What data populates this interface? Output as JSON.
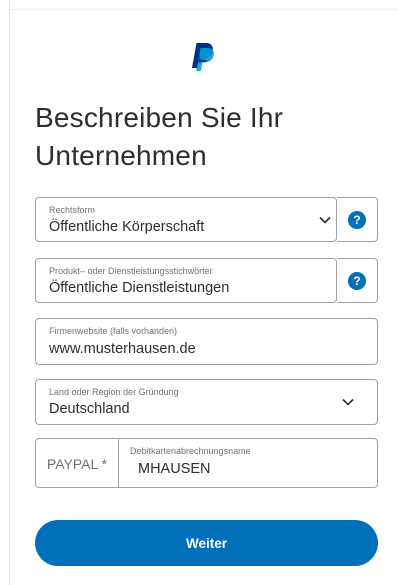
{
  "title": "Beschreiben Sie Ihr Unternehmen",
  "legal_form": {
    "label": "Rechtsform",
    "value": "Öffentliche Körperschaft"
  },
  "keywords": {
    "label": "Produkt– oder Dienstleistungsstichwörter",
    "value": "Öffentliche Dienstleistungen"
  },
  "website": {
    "label": "Firmenwebsite (falls vorhanden)",
    "value": "www.musterhausen.de"
  },
  "country": {
    "label": "Land oder Region der Gründung",
    "value": "Deutschland"
  },
  "card_name": {
    "prefix": "PAYPAL *",
    "label": "Debitkartenabrechnungsname",
    "value": "MHAUSEN"
  },
  "help_label": "?",
  "continue_label": "Weiter",
  "colors": {
    "brand_blue": "#0070ba",
    "brand_dark_blue": "#003087",
    "text": "#2c2e2f",
    "muted": "#6c7378",
    "border": "#9da3a6"
  },
  "icons": {
    "logo": "paypal-logo",
    "dropdown": "chevron-down-icon",
    "help": "help-icon"
  }
}
